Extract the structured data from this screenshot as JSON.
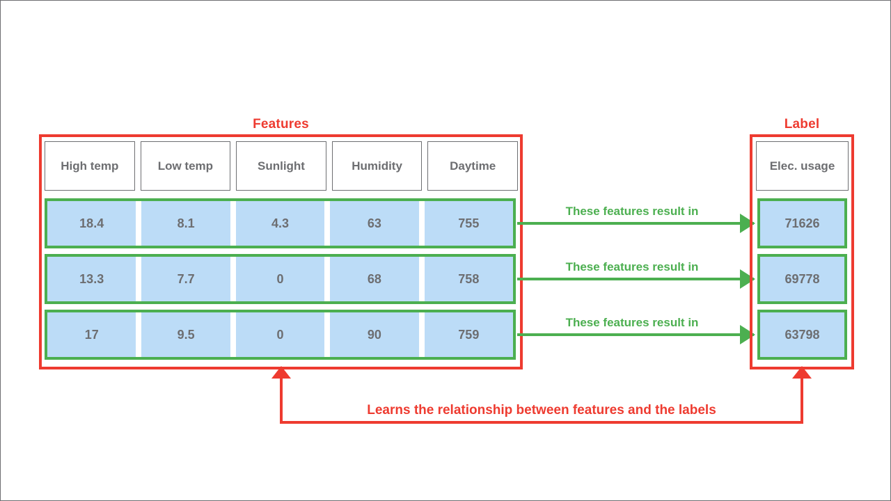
{
  "diagram": {
    "features_section": {
      "title": "Features",
      "headers": [
        "High temp",
        "Low temp",
        "Sunlight",
        "Humidity",
        "Daytime"
      ],
      "rows": [
        [
          "18.4",
          "8.1",
          "4.3",
          "63",
          "755"
        ],
        [
          "13.3",
          "7.7",
          "0",
          "68",
          "758"
        ],
        [
          "17",
          "9.5",
          "0",
          "90",
          "759"
        ]
      ]
    },
    "label_section": {
      "title": "Label",
      "headers": [
        "Elec. usage"
      ],
      "rows": [
        [
          "71626"
        ],
        [
          "69778"
        ],
        [
          "63798"
        ]
      ]
    },
    "connectors": [
      {
        "text": "These features result in"
      },
      {
        "text": "These features result in"
      },
      {
        "text": "These features result in"
      }
    ],
    "feedback": {
      "text": "Learns the relationship between features and the labels"
    },
    "colors": {
      "accent_red": "#ee3b30",
      "accent_green": "#4caf50",
      "cell_blue": "#bcdcf7",
      "text_gray": "#6d6e71"
    }
  }
}
